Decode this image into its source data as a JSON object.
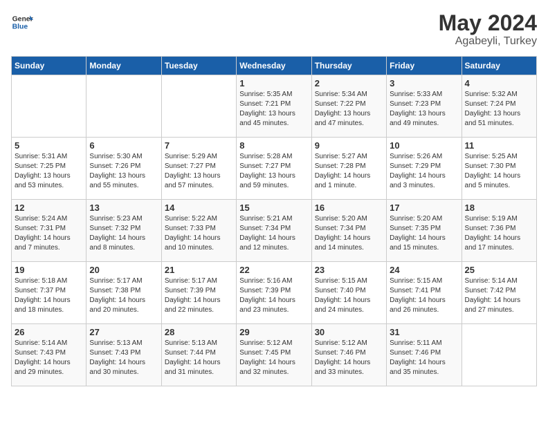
{
  "header": {
    "logo_line1": "General",
    "logo_line2": "Blue",
    "month_year": "May 2024",
    "location": "Agabeyli, Turkey"
  },
  "weekdays": [
    "Sunday",
    "Monday",
    "Tuesday",
    "Wednesday",
    "Thursday",
    "Friday",
    "Saturday"
  ],
  "weeks": [
    [
      {
        "day": "",
        "info": ""
      },
      {
        "day": "",
        "info": ""
      },
      {
        "day": "",
        "info": ""
      },
      {
        "day": "1",
        "info": "Sunrise: 5:35 AM\nSunset: 7:21 PM\nDaylight: 13 hours\nand 45 minutes."
      },
      {
        "day": "2",
        "info": "Sunrise: 5:34 AM\nSunset: 7:22 PM\nDaylight: 13 hours\nand 47 minutes."
      },
      {
        "day": "3",
        "info": "Sunrise: 5:33 AM\nSunset: 7:23 PM\nDaylight: 13 hours\nand 49 minutes."
      },
      {
        "day": "4",
        "info": "Sunrise: 5:32 AM\nSunset: 7:24 PM\nDaylight: 13 hours\nand 51 minutes."
      }
    ],
    [
      {
        "day": "5",
        "info": "Sunrise: 5:31 AM\nSunset: 7:25 PM\nDaylight: 13 hours\nand 53 minutes."
      },
      {
        "day": "6",
        "info": "Sunrise: 5:30 AM\nSunset: 7:26 PM\nDaylight: 13 hours\nand 55 minutes."
      },
      {
        "day": "7",
        "info": "Sunrise: 5:29 AM\nSunset: 7:27 PM\nDaylight: 13 hours\nand 57 minutes."
      },
      {
        "day": "8",
        "info": "Sunrise: 5:28 AM\nSunset: 7:27 PM\nDaylight: 13 hours\nand 59 minutes."
      },
      {
        "day": "9",
        "info": "Sunrise: 5:27 AM\nSunset: 7:28 PM\nDaylight: 14 hours\nand 1 minute."
      },
      {
        "day": "10",
        "info": "Sunrise: 5:26 AM\nSunset: 7:29 PM\nDaylight: 14 hours\nand 3 minutes."
      },
      {
        "day": "11",
        "info": "Sunrise: 5:25 AM\nSunset: 7:30 PM\nDaylight: 14 hours\nand 5 minutes."
      }
    ],
    [
      {
        "day": "12",
        "info": "Sunrise: 5:24 AM\nSunset: 7:31 PM\nDaylight: 14 hours\nand 7 minutes."
      },
      {
        "day": "13",
        "info": "Sunrise: 5:23 AM\nSunset: 7:32 PM\nDaylight: 14 hours\nand 8 minutes."
      },
      {
        "day": "14",
        "info": "Sunrise: 5:22 AM\nSunset: 7:33 PM\nDaylight: 14 hours\nand 10 minutes."
      },
      {
        "day": "15",
        "info": "Sunrise: 5:21 AM\nSunset: 7:34 PM\nDaylight: 14 hours\nand 12 minutes."
      },
      {
        "day": "16",
        "info": "Sunrise: 5:20 AM\nSunset: 7:34 PM\nDaylight: 14 hours\nand 14 minutes."
      },
      {
        "day": "17",
        "info": "Sunrise: 5:20 AM\nSunset: 7:35 PM\nDaylight: 14 hours\nand 15 minutes."
      },
      {
        "day": "18",
        "info": "Sunrise: 5:19 AM\nSunset: 7:36 PM\nDaylight: 14 hours\nand 17 minutes."
      }
    ],
    [
      {
        "day": "19",
        "info": "Sunrise: 5:18 AM\nSunset: 7:37 PM\nDaylight: 14 hours\nand 18 minutes."
      },
      {
        "day": "20",
        "info": "Sunrise: 5:17 AM\nSunset: 7:38 PM\nDaylight: 14 hours\nand 20 minutes."
      },
      {
        "day": "21",
        "info": "Sunrise: 5:17 AM\nSunset: 7:39 PM\nDaylight: 14 hours\nand 22 minutes."
      },
      {
        "day": "22",
        "info": "Sunrise: 5:16 AM\nSunset: 7:39 PM\nDaylight: 14 hours\nand 23 minutes."
      },
      {
        "day": "23",
        "info": "Sunrise: 5:15 AM\nSunset: 7:40 PM\nDaylight: 14 hours\nand 24 minutes."
      },
      {
        "day": "24",
        "info": "Sunrise: 5:15 AM\nSunset: 7:41 PM\nDaylight: 14 hours\nand 26 minutes."
      },
      {
        "day": "25",
        "info": "Sunrise: 5:14 AM\nSunset: 7:42 PM\nDaylight: 14 hours\nand 27 minutes."
      }
    ],
    [
      {
        "day": "26",
        "info": "Sunrise: 5:14 AM\nSunset: 7:43 PM\nDaylight: 14 hours\nand 29 minutes."
      },
      {
        "day": "27",
        "info": "Sunrise: 5:13 AM\nSunset: 7:43 PM\nDaylight: 14 hours\nand 30 minutes."
      },
      {
        "day": "28",
        "info": "Sunrise: 5:13 AM\nSunset: 7:44 PM\nDaylight: 14 hours\nand 31 minutes."
      },
      {
        "day": "29",
        "info": "Sunrise: 5:12 AM\nSunset: 7:45 PM\nDaylight: 14 hours\nand 32 minutes."
      },
      {
        "day": "30",
        "info": "Sunrise: 5:12 AM\nSunset: 7:46 PM\nDaylight: 14 hours\nand 33 minutes."
      },
      {
        "day": "31",
        "info": "Sunrise: 5:11 AM\nSunset: 7:46 PM\nDaylight: 14 hours\nand 35 minutes."
      },
      {
        "day": "",
        "info": ""
      }
    ]
  ]
}
